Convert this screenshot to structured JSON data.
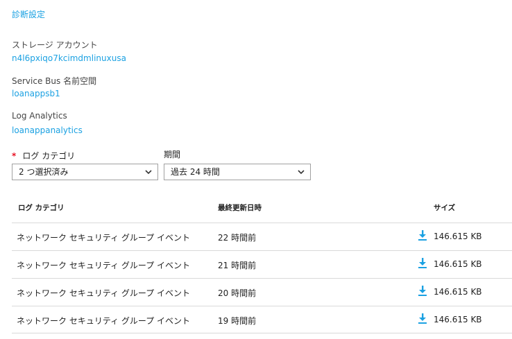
{
  "header": {
    "diagnostic_settings_link": "診断設定"
  },
  "storage": {
    "label": "ストレージ アカウント",
    "value": "n4l6pxiqo7kcimdmlinuxusa"
  },
  "service_bus": {
    "label": "Service Bus 名前空間",
    "value": "loanappsb1"
  },
  "log_analytics": {
    "label": "Log Analytics",
    "value": "loanappanalytics"
  },
  "filters": {
    "required_mark": "*",
    "category_label": "ログ カテゴリ",
    "category_value": "2 つ選択済み",
    "period_label": "期間",
    "period_value": "過去 24 時間"
  },
  "table": {
    "headers": {
      "category": "ログ カテゴリ",
      "updated": "最終更新日時",
      "size": "サイズ"
    },
    "rows": [
      {
        "category": "ネットワーク セキュリティ グループ イベント",
        "updated": "22 時間前",
        "size": "146.615 KB"
      },
      {
        "category": "ネットワーク セキュリティ グループ イベント",
        "updated": "21 時間前",
        "size": "146.615 KB"
      },
      {
        "category": "ネットワーク セキュリティ グループ イベント",
        "updated": "20 時間前",
        "size": "146.615 KB"
      },
      {
        "category": "ネットワーク セキュリティ グループ イベント",
        "updated": "19 時間前",
        "size": "146.615 KB"
      }
    ]
  },
  "icons": {
    "dropdown": "chevron-down-icon",
    "download": "download-icon"
  },
  "colors": {
    "link": "#1ba1e2",
    "required": "#e81123",
    "download_icon": "#1ba1e2",
    "row_border": "#d9d9d9"
  }
}
